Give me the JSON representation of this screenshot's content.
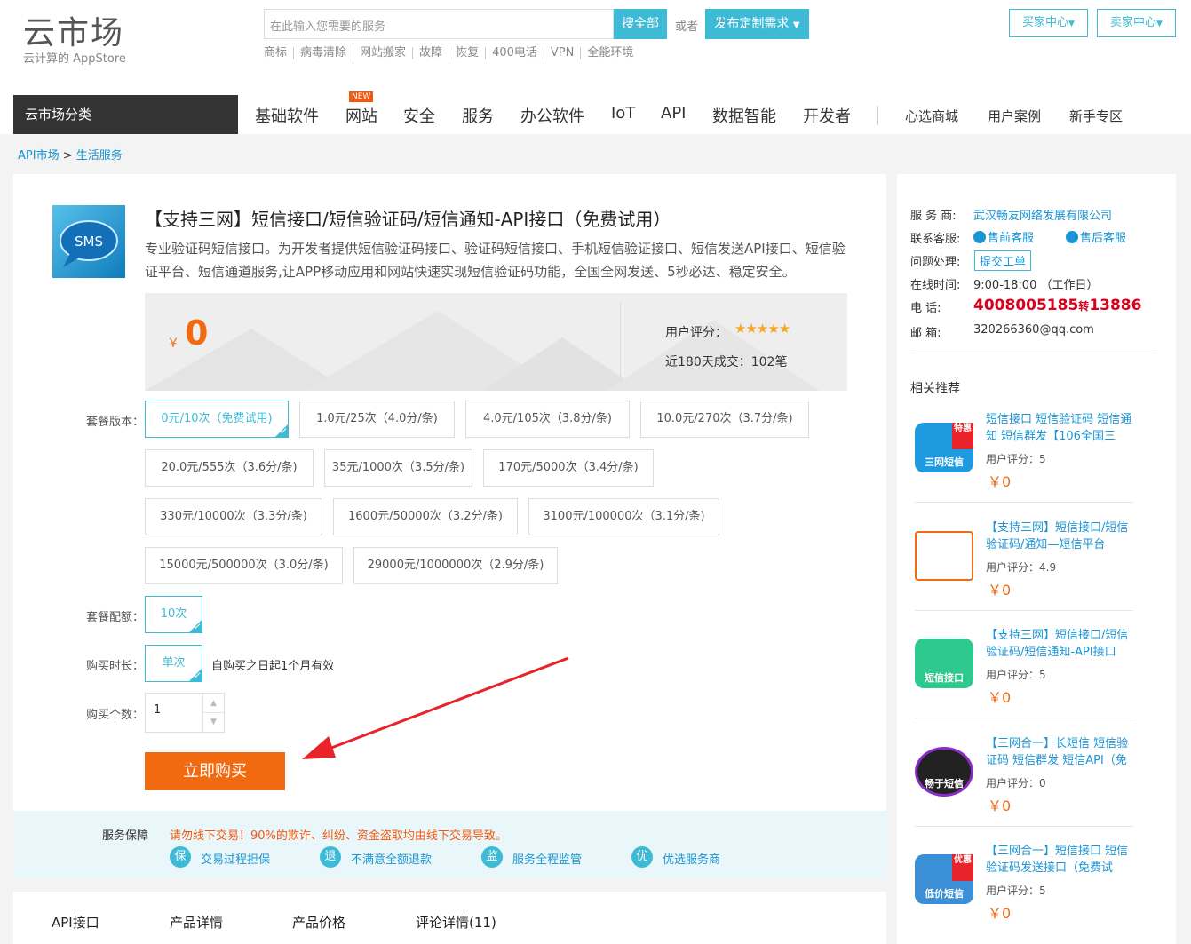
{
  "header": {
    "logo_title": "云市场",
    "logo_sub": "云计算的 AppStore",
    "search_placeholder": "在此输入您需要的服务",
    "search_button": "搜全部",
    "or_text": "或者",
    "publish_button": "发布定制需求",
    "hot_links": [
      "商标",
      "病毒清除",
      "网站搬家",
      "故障",
      "恢复",
      "400电话",
      "VPN",
      "全能环境"
    ],
    "buyer_center": "买家中心",
    "seller_center": "卖家中心"
  },
  "nav": {
    "category": "云市场分类",
    "items": [
      "基础软件",
      "网站",
      "安全",
      "服务",
      "办公软件",
      "IoT",
      "API",
      "数据智能",
      "开发者"
    ],
    "new_badge": "NEW",
    "right_items": [
      "心选商城",
      "用户案例",
      "新手专区"
    ]
  },
  "breadcrumb": {
    "root": "API市场",
    "sep": ">",
    "current": "生活服务"
  },
  "product": {
    "icon_text": "SMS",
    "title": "【支持三网】短信接口/短信验证码/短信通知-API接口（免费试用）",
    "description": "专业验证码短信接口。为开发者提供短信验证码接口、验证码短信接口、手机短信验证接口、短信发送API接口、短信验证平台、短信通道服务,让APP移动应用和网站快速实现短信验证码功能，全国全网发送、5秒必达、稳定安全。",
    "price_symbol": "￥",
    "price": "0",
    "rating_label": "用户评分：",
    "rating_stars": 5,
    "deals": "近180天成交：102笔",
    "package_label": "套餐版本：",
    "packages": [
      {
        "label": "0元/10次（免费试用)",
        "selected": true
      },
      {
        "label": "1.0元/25次（4.0分/条)",
        "selected": false
      },
      {
        "label": "4.0元/105次（3.8分/条)",
        "selected": false
      },
      {
        "label": "10.0元/270次（3.7分/条)",
        "selected": false
      },
      {
        "label": "20.0元/555次（3.6分/条)",
        "selected": false
      },
      {
        "label": "35元/1000次（3.5分/条)",
        "selected": false
      },
      {
        "label": "170元/5000次（3.4分/条)",
        "selected": false
      },
      {
        "label": "330元/10000次（3.3分/条)",
        "selected": false
      },
      {
        "label": "1600元/50000次（3.2分/条)",
        "selected": false
      },
      {
        "label": "3100元/100000次（3.1分/条)",
        "selected": false
      },
      {
        "label": "15000元/500000次（3.0分/条)",
        "selected": false
      },
      {
        "label": "29000元/1000000次（2.9分/条)",
        "selected": false
      }
    ],
    "config_label": "套餐配额：",
    "config_value": "10次",
    "duration_label": "购买时长：",
    "duration_value": "单次",
    "duration_note": "自购买之日起1个月有效",
    "qty_label": "购买个数：",
    "qty_value": "1",
    "buy_button": "立即购买"
  },
  "guarantee": {
    "label": "服务保障",
    "warning": "请勿线下交易！90%的欺诈、纠纷、资金盗取均由线下交易导致。",
    "items": [
      {
        "icon": "保",
        "text": "交易过程担保"
      },
      {
        "icon": "退",
        "text": "不满意全额退款"
      },
      {
        "icon": "监",
        "text": "服务全程监管"
      },
      {
        "icon": "优",
        "text": "优选服务商"
      }
    ]
  },
  "tabs": [
    "API接口",
    "产品详情",
    "产品价格",
    "评论详情(11)"
  ],
  "seller": {
    "provider_label": "服 务 商:",
    "provider": "武汉畅友网络发展有限公司",
    "contact_label": "联系客服:",
    "presale": "售前客服",
    "aftersale": "售后客服",
    "issue_label": "问题处理:",
    "ticket": "提交工单",
    "hours_label": "在线时间:",
    "hours": "9:00-18:00 （工作日）",
    "phone_label": "电 话:",
    "phone_main": "4008005185",
    "phone_ext_label": "转",
    "phone_ext": "13886",
    "email_label": "邮 箱:",
    "email": "320266360@qq.com"
  },
  "related": {
    "title": "相关推荐",
    "items": [
      {
        "title": "短信接口 短信验证码 短信通知 短信群发【106全国三",
        "rating": "用户评分：5",
        "price": "￥0",
        "badge": "特惠",
        "caption": "三网短信",
        "color": "#1e9be0"
      },
      {
        "title": "【支持三网】短信接口/短信验证码/通知—短信平台",
        "rating": "用户评分：4.9",
        "price": "￥0",
        "badge": "",
        "caption": "",
        "color": "#f26a10"
      },
      {
        "title": "【支持三网】短信接口/短信验证码/短信通知-API接口",
        "rating": "用户评分：5",
        "price": "￥0",
        "badge": "",
        "caption": "短信接口",
        "color": "#2ec98e"
      },
      {
        "title": "【三网合一】长短信 短信验证码 短信群发 短信API（免",
        "rating": "用户评分：0",
        "price": "￥0",
        "badge": "",
        "caption": "畅于短信",
        "color": "#8a2cc8"
      },
      {
        "title": "【三网合一】短信接口 短信验证码发送接口（免费试",
        "rating": "用户评分：5",
        "price": "￥0",
        "badge": "优惠",
        "caption": "低价短信",
        "color": "#3a8fd6"
      }
    ]
  },
  "colors": {
    "accent": "#3dbbd6",
    "orange": "#f26a10",
    "link": "#1a96d4",
    "red": "#d9001b"
  }
}
